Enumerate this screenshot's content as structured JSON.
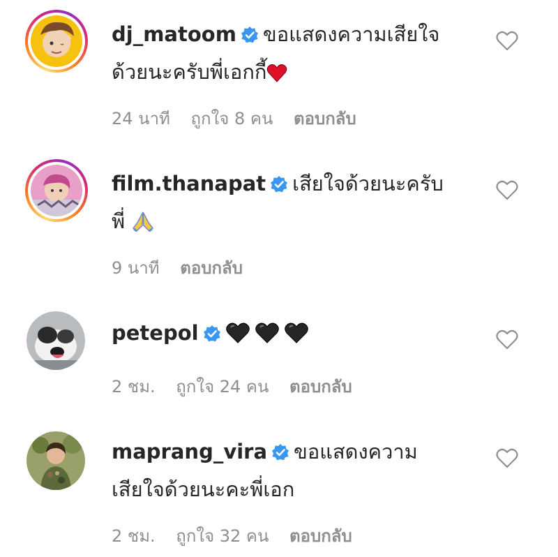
{
  "comments": [
    {
      "username": "dj_matoom",
      "text_line1": "ขอแสดงความเสียใจ",
      "text_line2": "ด้วยนะครับพี่เอกกี้",
      "time": "24 นาที",
      "likes": "ถูกใจ 8 คน",
      "reply": "ตอบกลับ",
      "emoji": [
        "red-heart"
      ]
    },
    {
      "username": "film.thanapat",
      "text_line1": "เสียใจด้วยนะครับ",
      "text_line2": "พี่",
      "time": "9 นาที",
      "likes": "",
      "reply": "ตอบกลับ",
      "emoji": [
        "folded-hands"
      ]
    },
    {
      "username": "petepol",
      "text_line1": "",
      "time": "2 ชม.",
      "likes": "ถูกใจ 24 คน",
      "reply": "ตอบกลับ",
      "emoji": [
        "black-heart",
        "black-heart",
        "black-heart"
      ]
    },
    {
      "username": "maprang_vira",
      "text_line1": "ขอแสดงความ",
      "text_line2": "เสียใจด้วยนะคะพี่เอก",
      "time": "2 ชม.",
      "likes": "ถูกใจ 32 คน",
      "reply": "ตอบกลับ"
    }
  ],
  "colors": {
    "verified": "#3897f0",
    "meta_text": "#8e8e8e",
    "heart_outline": "#8e8e8e",
    "red_heart": "#e0102a",
    "black_heart": "#262626"
  }
}
